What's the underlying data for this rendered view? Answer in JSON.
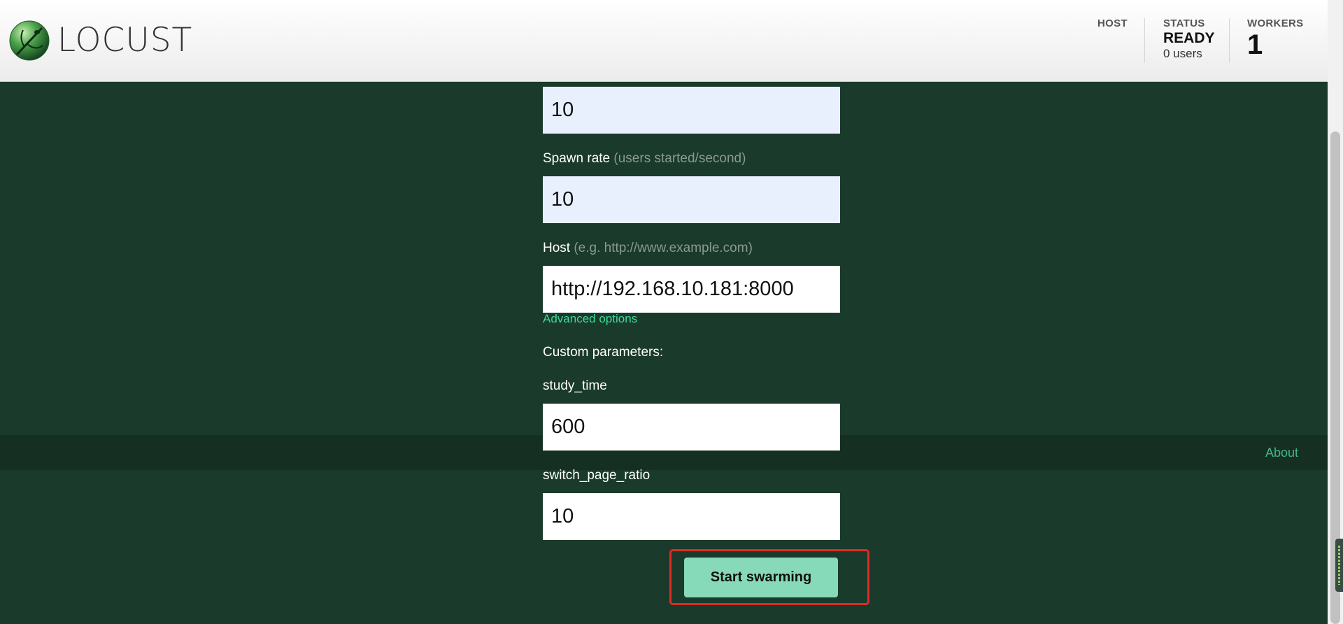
{
  "header": {
    "logo_text": "LOCUST",
    "host_label": "HOST",
    "status_label": "STATUS",
    "status_value": "READY",
    "status_users": "0 users",
    "workers_label": "WORKERS",
    "workers_value": "1"
  },
  "form": {
    "users_value": "10",
    "spawn_rate_label": "Spawn rate",
    "spawn_rate_hint": "(users started/second)",
    "spawn_rate_value": "10",
    "host_label": "Host",
    "host_hint": "(e.g. http://www.example.com)",
    "host_value": "http://192.168.10.181:8000",
    "advanced_options": "Advanced options",
    "custom_parameters_label": "Custom parameters:",
    "study_time_label": "study_time",
    "study_time_value": "600",
    "switch_page_ratio_label": "switch_page_ratio",
    "switch_page_ratio_value": "10",
    "start_button": "Start swarming"
  },
  "footer": {
    "about": "About"
  },
  "colors": {
    "page_background": "#1a3a2b",
    "footer_band": "#162f23",
    "accent_link": "#3ddc97",
    "start_button": "#86d9b9",
    "highlight": "#e02b24"
  },
  "icons": {
    "logo": "locust-logo-icon"
  }
}
